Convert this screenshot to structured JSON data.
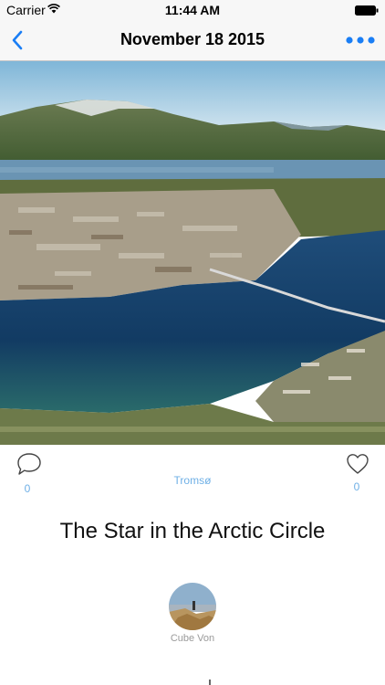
{
  "status_bar": {
    "carrier": "Carrier",
    "time": "11:44 AM"
  },
  "nav": {
    "title": "November 18 2015",
    "back_icon": "chevron-left-icon",
    "more_icon": "ellipsis-icon"
  },
  "post": {
    "comments_count": "0",
    "likes_count": "0",
    "location": "Tromsø",
    "title": "The Star in the Arctic Circle",
    "author": "Cube Von"
  },
  "colors": {
    "accent": "#1a7ef5",
    "count_blue": "#6fb0e6",
    "nav_bg": "#f7f7f7"
  }
}
